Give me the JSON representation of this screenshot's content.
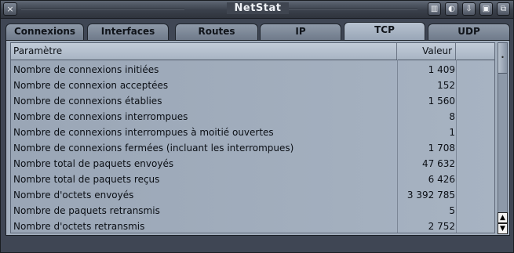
{
  "window": {
    "title": "NetStat",
    "close_glyph": "×",
    "buttons": [
      {
        "name": "iconify-button",
        "glyph": "▥"
      },
      {
        "name": "snapshot-button",
        "glyph": "◐"
      },
      {
        "name": "download-button",
        "glyph": "⇩"
      },
      {
        "name": "zoom-button",
        "glyph": "▣"
      },
      {
        "name": "depth-button",
        "glyph": "⧉"
      }
    ]
  },
  "tabs": [
    {
      "label": "Connexions",
      "active": false
    },
    {
      "label": "Interfaces",
      "active": false
    },
    {
      "label": "Routes",
      "active": false
    },
    {
      "label": "IP",
      "active": false
    },
    {
      "label": "TCP",
      "active": true
    },
    {
      "label": "UDP",
      "active": false
    }
  ],
  "table": {
    "headers": {
      "param": "Paramètre",
      "value": "Valeur",
      "extra": ""
    },
    "rows": [
      {
        "param": "Nombre de connexions initiées",
        "value": "1 409"
      },
      {
        "param": "Nombre de connexion acceptées",
        "value": "152"
      },
      {
        "param": "Nombre de connexions établies",
        "value": "1 560"
      },
      {
        "param": "Nombre de connexions interrompues",
        "value": "8"
      },
      {
        "param": "Nombre de connexions interrompues à moitié ouvertes",
        "value": "1"
      },
      {
        "param": "Nombre de connexions fermées (incluant les interrompues)",
        "value": "1 708"
      },
      {
        "param": "Nombre total de paquets envoyés",
        "value": "47 632"
      },
      {
        "param": "Nombre total de paquets reçus",
        "value": "6 426"
      },
      {
        "param": "Nombre d'octets envoyés",
        "value": "3 392 785"
      },
      {
        "param": "Nombre de paquets retransmis",
        "value": "5"
      },
      {
        "param": "Nombre d'octets retransmis",
        "value": "2 752"
      }
    ]
  },
  "scrollbar": {
    "up_glyph": "▲",
    "down_glyph": "▼",
    "thumb_glyph": "•"
  }
}
